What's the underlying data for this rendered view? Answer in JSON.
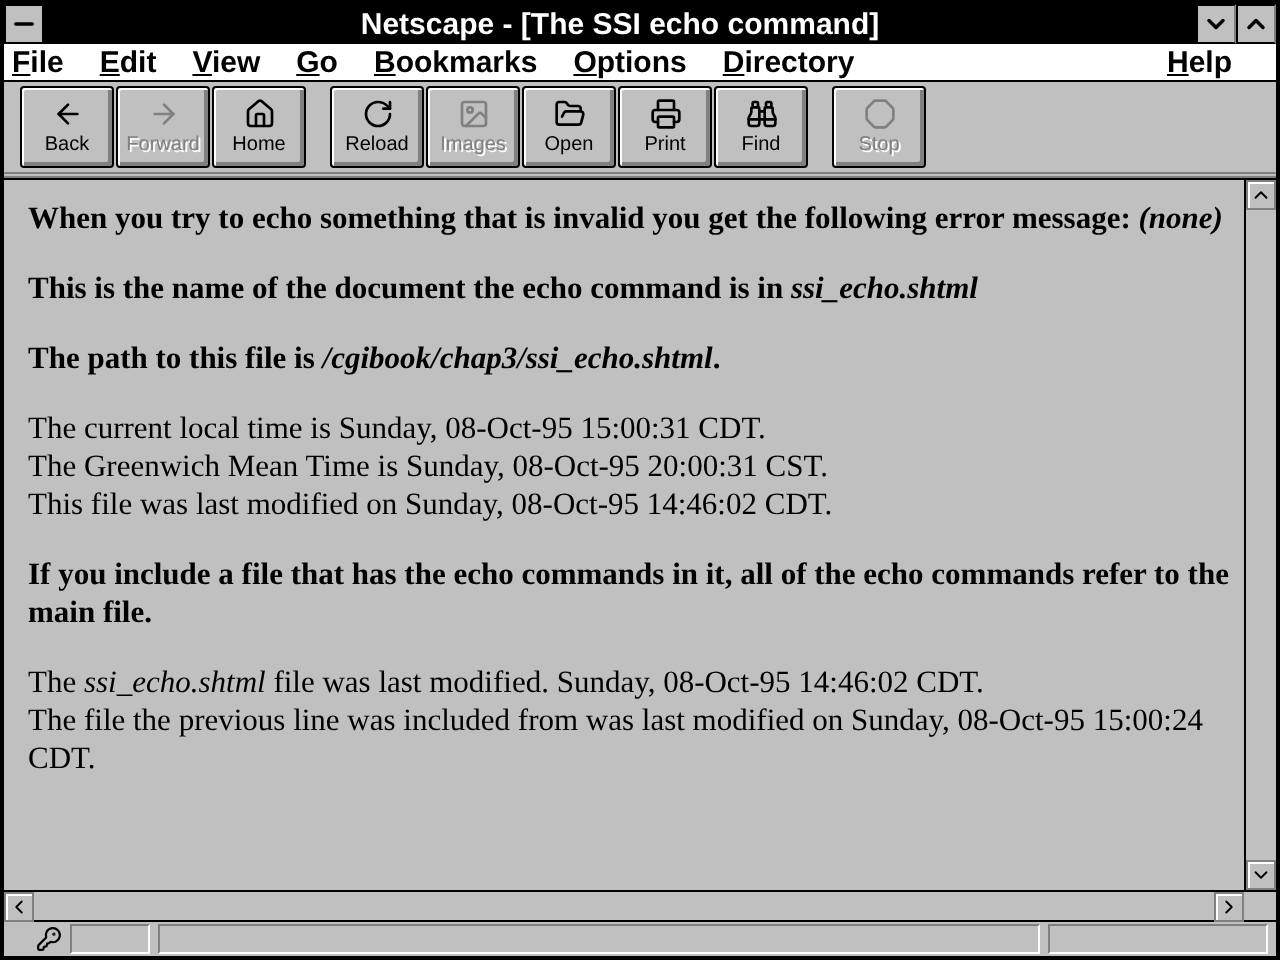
{
  "window": {
    "title": "Netscape - [The SSI echo command]"
  },
  "menu": [
    {
      "label": "File"
    },
    {
      "label": "Edit"
    },
    {
      "label": "View"
    },
    {
      "label": "Go"
    },
    {
      "label": "Bookmarks"
    },
    {
      "label": "Options"
    },
    {
      "label": "Directory"
    },
    {
      "label": "Help"
    }
  ],
  "toolbar": [
    [
      {
        "label": "Back",
        "disabled": false
      },
      {
        "label": "Forward",
        "disabled": true
      },
      {
        "label": "Home",
        "disabled": false
      }
    ],
    [
      {
        "label": "Reload",
        "disabled": false
      },
      {
        "label": "Images",
        "disabled": true
      },
      {
        "label": "Open",
        "disabled": false
      },
      {
        "label": "Print",
        "disabled": false
      },
      {
        "label": "Find",
        "disabled": false
      }
    ],
    [
      {
        "label": "Stop",
        "disabled": true
      }
    ]
  ],
  "content": [
    {
      "kind": "bold",
      "lines": [
        "When you try to echo something that is invalid you get the following error message: *(none)*"
      ]
    },
    {
      "kind": "bold",
      "lines": [
        "This is the name of the document the echo command is in *ssi_echo.shtml*"
      ]
    },
    {
      "kind": "bold",
      "lines": [
        "The path to this file is */cgibook/chap3/ssi_echo.shtml*."
      ]
    },
    {
      "kind": "plain",
      "lines": [
        "The current local time is Sunday, 08-Oct-95 15:00:31 CDT.",
        "The Greenwich Mean Time is Sunday, 08-Oct-95 20:00:31 CST.",
        "This file was last modified on Sunday, 08-Oct-95 14:46:02 CDT."
      ]
    },
    {
      "kind": "bold",
      "lines": [
        "If you include a file that has the echo commands in it, all of the echo commands refer to the main file."
      ]
    },
    {
      "kind": "plain",
      "lines": [
        "The *ssi_echo.shtml* file was last modified. Sunday, 08-Oct-95 14:46:02 CDT.",
        "The file the previous line was included from was last modified on Sunday, 08-Oct-95 15:00:24 CDT."
      ]
    }
  ]
}
